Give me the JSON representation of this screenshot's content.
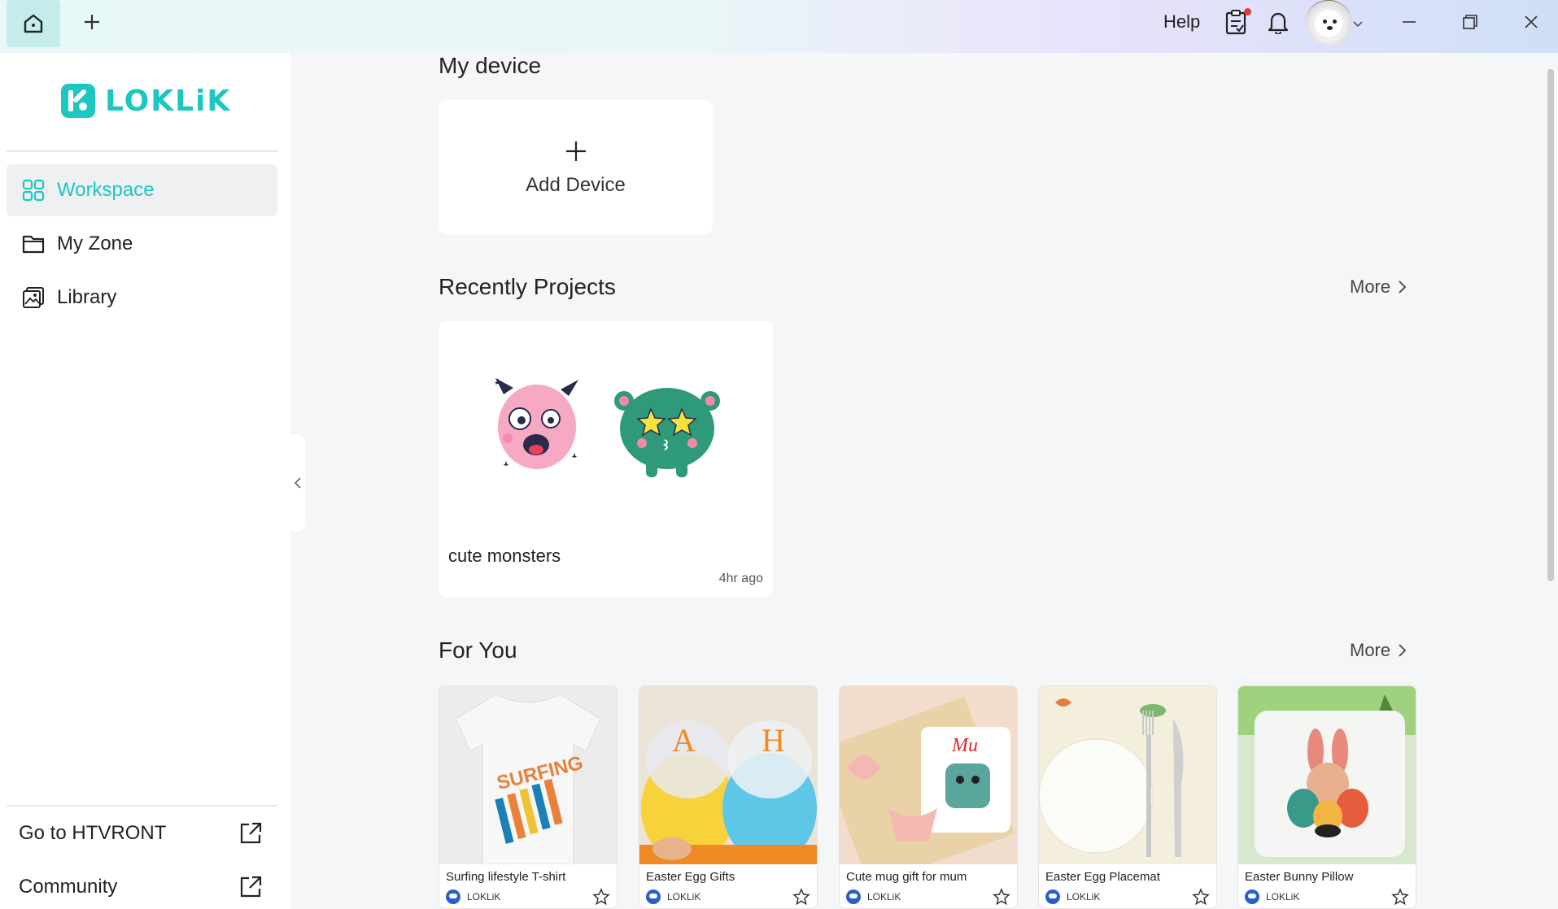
{
  "titlebar": {
    "home_icon": "home-icon",
    "new_tab_icon": "plus-icon",
    "help_label": "Help",
    "tasks_icon": "clipboard-icon",
    "bell_icon": "bell-icon",
    "avatar_alt": "user avatar",
    "window_controls": [
      "minimize-icon",
      "restore-icon",
      "close-icon"
    ]
  },
  "sidebar": {
    "logo_text": "LOKLiK",
    "items": [
      {
        "label": "Workspace",
        "icon": "grid-icon",
        "active": true
      },
      {
        "label": "My Zone",
        "icon": "folder-icon",
        "active": false
      },
      {
        "label": "Library",
        "icon": "image-library-icon",
        "active": false
      }
    ],
    "footer": [
      {
        "label": "Go to HTVRONT",
        "icon": "external-link-icon"
      },
      {
        "label": "Community",
        "icon": "external-link-icon"
      }
    ]
  },
  "main": {
    "my_device": {
      "title": "My device",
      "add_label": "Add Device"
    },
    "recent": {
      "title": "Recently Projects",
      "more_label": "More",
      "projects": [
        {
          "name": "cute monsters",
          "time": "4hr ago"
        }
      ]
    },
    "for_you": {
      "title": "For You",
      "more_label": "More",
      "items": [
        {
          "title": "Surfing lifestyle T-shirt",
          "author": "LOKLiK"
        },
        {
          "title": "Easter Egg Gifts",
          "author": "LOKLiK"
        },
        {
          "title": "Cute mug gift for mum",
          "author": "LOKLiK"
        },
        {
          "title": "Easter Egg Placemat",
          "author": "LOKLiK"
        },
        {
          "title": "Easter Bunny Pillow",
          "author": "LOKLiK"
        }
      ]
    }
  },
  "colors": {
    "brand": "#1cc7c1",
    "notification_dot": "#e53935"
  }
}
